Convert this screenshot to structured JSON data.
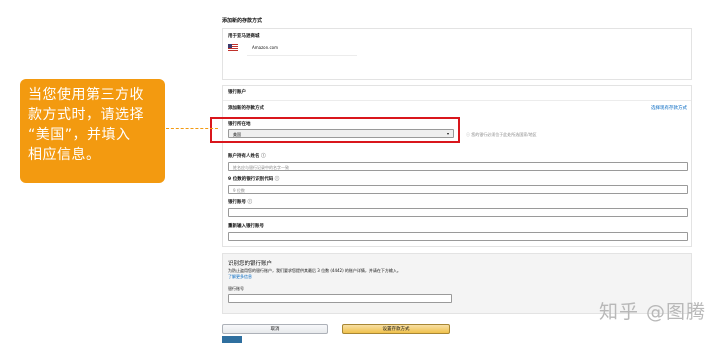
{
  "page": {
    "title": "添加新的存款方式"
  },
  "marketplace": {
    "heading": "用于亚马逊商城",
    "name": "Amazon.com"
  },
  "bank_section": {
    "heading": "银行账户",
    "subheading": "添加新的存款方式",
    "link": "选择现有存款方式",
    "country_label": "银行所在地",
    "country_value": "美国",
    "country_note": "您的银行必须位于此处所选国家/地区",
    "holder_label": "账户持有人姓名",
    "holder_placeholder": "姓名应与银行记录中的名字一致",
    "routing_label": "9 位数的银行识别代码",
    "routing_placeholder": "9 位数",
    "account_label": "银行账号",
    "account_value": "",
    "confirm_label": "重新输入银行账号",
    "confirm_value": ""
  },
  "identify_section": {
    "heading": "识别您的银行账户",
    "description": "为防止盗用您的银行账户，我们要求您提供其最后 3 位数 (4442) 的账户详情，并请在下方输入。",
    "link": "了解更多信息",
    "field_label": "银行账号",
    "field_value": ""
  },
  "actions": {
    "cancel": "取消",
    "submit": "设置存款方式"
  },
  "callout": {
    "lines": [
      "当您使用第三方收",
      "款方式时，请选择",
      "“美国”，并填入",
      "相应信息。"
    ]
  },
  "watermark": "知乎 @图腾",
  "colors": {
    "callout": "#f39a10",
    "highlight_border": "#d9161c",
    "link": "#0066c0",
    "submit_button": "#f0c14b"
  },
  "icons": {
    "flag": "us-flag-icon",
    "dropdown": "chevron-down-icon",
    "info": "info-icon"
  }
}
